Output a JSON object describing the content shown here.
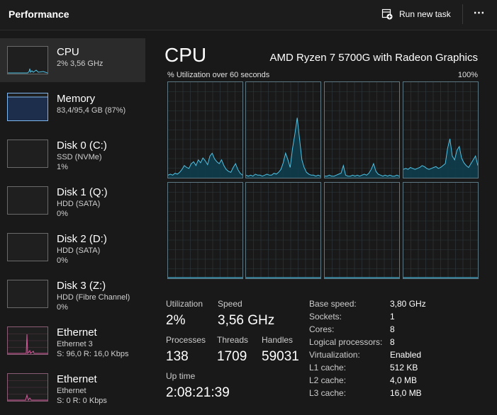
{
  "header": {
    "title": "Performance",
    "run_new_task": "Run new task",
    "run_new_task_icon": "run-task-icon",
    "more_icon": "more-options-icon",
    "more_glyph": "⋯"
  },
  "colors": {
    "cpu_line": "#4ec3e6",
    "cpu_fill": "#103d4d",
    "memory": "#7eb6f0",
    "memory_fill": "#1c2e4c",
    "ethernet": "#d65a9c",
    "grid": "#2f3a3f",
    "graph_border": "#5e7883"
  },
  "sidebar": {
    "items": [
      {
        "name": "CPU",
        "sub": "2% 3,56 GHz",
        "sub2": "",
        "kind": "cpu",
        "selected": true
      },
      {
        "name": "Memory",
        "sub": "83,4/95,4 GB (87%)",
        "sub2": "",
        "kind": "memory",
        "selected": false,
        "level": 0.87
      },
      {
        "name": "Disk 0 (C:)",
        "sub": "SSD (NVMe)",
        "sub2": "1%",
        "kind": "disk",
        "selected": false
      },
      {
        "name": "Disk 1 (Q:)",
        "sub": "HDD (SATA)",
        "sub2": "0%",
        "kind": "disk",
        "selected": false
      },
      {
        "name": "Disk 2 (D:)",
        "sub": "HDD (SATA)",
        "sub2": "0%",
        "kind": "disk",
        "selected": false
      },
      {
        "name": "Disk 3 (Z:)",
        "sub": "HDD (Fibre Channel)",
        "sub2": "0%",
        "kind": "disk",
        "selected": false
      },
      {
        "name": "Ethernet",
        "sub": "Ethernet 3",
        "sub2": "S: 96,0  R: 16,0 Kbps",
        "kind": "ethernet",
        "selected": false
      },
      {
        "name": "Ethernet",
        "sub": "Ethernet",
        "sub2": "S: 0  R: 0 Kbps",
        "kind": "ethernet2",
        "selected": false
      }
    ]
  },
  "main": {
    "title": "CPU",
    "model": "AMD Ryzen 7 5700G with Radeon Graphics",
    "util_label": "% Utilization over 60 seconds",
    "util_max": "100%",
    "cores": [
      [
        2,
        3,
        2,
        4,
        3,
        5,
        8,
        12,
        10,
        9,
        14,
        16,
        12,
        18,
        15,
        20,
        17,
        13,
        22,
        25,
        19,
        16,
        14,
        18,
        12,
        8,
        6,
        5,
        10,
        14,
        8,
        4,
        2
      ],
      [
        2,
        1,
        2,
        1,
        3,
        2,
        2,
        1,
        2,
        3,
        2,
        2,
        4,
        3,
        5,
        8,
        15,
        25,
        18,
        10,
        30,
        45,
        62,
        40,
        18,
        10,
        5,
        3,
        2,
        2,
        1,
        2,
        1
      ],
      [
        1,
        1,
        2,
        1,
        1,
        2,
        3,
        4,
        12,
        2,
        1,
        1,
        2,
        1,
        2,
        1,
        2,
        3,
        2,
        4,
        8,
        14,
        6,
        3,
        2,
        1,
        2,
        1,
        2,
        1,
        1,
        2,
        1
      ],
      [
        8,
        9,
        8,
        10,
        9,
        8,
        9,
        10,
        12,
        11,
        9,
        8,
        9,
        10,
        11,
        9,
        10,
        12,
        14,
        30,
        40,
        22,
        18,
        28,
        32,
        20,
        15,
        12,
        10,
        14,
        18,
        22,
        12
      ]
    ],
    "cores_low": [
      [
        0,
        0,
        0,
        0,
        0,
        0,
        0,
        0,
        0,
        0,
        0,
        0,
        0,
        0,
        0,
        0,
        0,
        0,
        0,
        0,
        0,
        0,
        0,
        0,
        0,
        0,
        0,
        0,
        0,
        0,
        0,
        0,
        0
      ],
      [
        0,
        0,
        0,
        0,
        0,
        0,
        0,
        0,
        0,
        0,
        0,
        0,
        0,
        0,
        0,
        0,
        0,
        0,
        0,
        0,
        0,
        0,
        0,
        0,
        0,
        0,
        0,
        0,
        0,
        0,
        0,
        0,
        0
      ],
      [
        0,
        0,
        0,
        0,
        0,
        0,
        0,
        0,
        0,
        0,
        0,
        0,
        0,
        0,
        0,
        0,
        0,
        0,
        0,
        0,
        0,
        0,
        0,
        0,
        0,
        0,
        0,
        0,
        0,
        0,
        0,
        0,
        0
      ],
      [
        0,
        0,
        0,
        0,
        0,
        0,
        0,
        0,
        0,
        0,
        0,
        0,
        0,
        0,
        0,
        0,
        0,
        0,
        0,
        0,
        0,
        0,
        0,
        0,
        0,
        0,
        0,
        0,
        0,
        0,
        0,
        0,
        0
      ]
    ],
    "stats": {
      "utilization_label": "Utilization",
      "utilization": "2%",
      "speed_label": "Speed",
      "speed": "3,56 GHz",
      "processes_label": "Processes",
      "processes": "138",
      "threads_label": "Threads",
      "threads": "1709",
      "handles_label": "Handles",
      "handles": "59031",
      "uptime_label": "Up time",
      "uptime": "2:08:21:39"
    },
    "specs": [
      {
        "label": "Base speed:",
        "value": "3,80 GHz"
      },
      {
        "label": "Sockets:",
        "value": "1"
      },
      {
        "label": "Cores:",
        "value": "8"
      },
      {
        "label": "Logical processors:",
        "value": "8"
      },
      {
        "label": "Virtualization:",
        "value": "Enabled"
      },
      {
        "label": "L1 cache:",
        "value": "512 KB"
      },
      {
        "label": "L2 cache:",
        "value": "4,0 MB"
      },
      {
        "label": "L3 cache:",
        "value": "16,0 MB"
      }
    ]
  }
}
